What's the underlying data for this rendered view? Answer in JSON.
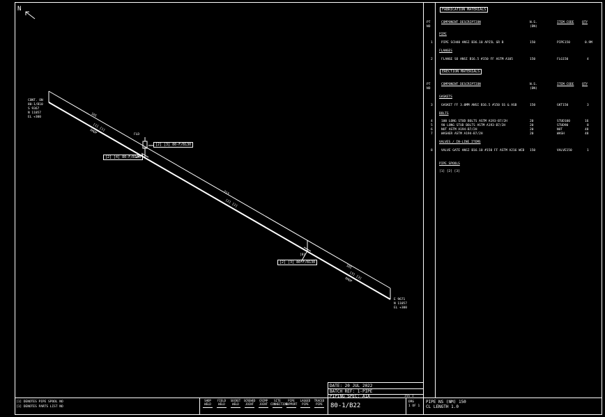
{
  "north": {
    "label": "N"
  },
  "start_point": {
    "lines": [
      "CONT. ON",
      "80-1/B10",
      "S 9367",
      "N 11057",
      "EL +300"
    ]
  },
  "end_point": {
    "lines": [
      "E 9671",
      "N 11057",
      "EL +300"
    ]
  },
  "iso": {
    "dim_1": "165",
    "dim_2": "713",
    "dim_3": "165",
    "spool_1": "[1] [1]",
    "spool_2": "[2] [2]",
    "spool_3": "[3] [3]",
    "pipe_note_1": "SHOP",
    "pipe_note_2": "SHOP",
    "field_label_1": "FLD",
    "field_label_2": "FLD",
    "weld_ref_1": "[2] [3] 80-F/B130",
    "weld_ref_2": "[2] [4] 80-F/B130",
    "weld_ref_3": "[2] [3] 80-F/B130",
    "valve_tag": "[8]"
  },
  "bom": {
    "fab_title": "FABRICATION MATERIALS",
    "ere_title": "ERECTION MATERIALS",
    "headers": {
      "pt": "PT",
      "no": "NO",
      "desc": "COMPONENT DESCRIPTION",
      "ns": "N.S.",
      "dn": "(DN)",
      "code": "ITEM CODE",
      "qty": "QTY"
    },
    "fab_groups": [
      {
        "name": "PIPE",
        "rows": [
          {
            "pt": "1",
            "desc": "PIPE SCH40 ANSI B36.10 API5L GR B",
            "ns": "150",
            "code": "PIPE150",
            "qty": "0.9M"
          }
        ]
      },
      {
        "name": "FLANGES",
        "rows": [
          {
            "pt": "2",
            "desc": "FLANGE SO ANSI B16.5 #150 FF ASTM A105",
            "ns": "150",
            "code": "FLG150",
            "qty": "4"
          }
        ]
      }
    ],
    "ere_groups": [
      {
        "name": "GASKETS",
        "rows": [
          {
            "pt": "3",
            "desc": "GASKET FF 3.0MM ANSI B16.5 #150 SS & ASB",
            "ns": "150",
            "code": "GKT150",
            "qty": "3"
          }
        ]
      },
      {
        "name": "BOLTS",
        "rows": [
          {
            "pt": "4",
            "desc": "100 LONG STUD BOLTS ASTM A193-B7/2H",
            "ns": "20",
            "code": "STUD100",
            "qty": "16"
          },
          {
            "pt": "5",
            "desc": "90 LONG STUD BOLTS ASTM A193-B7/2H",
            "ns": "20",
            "code": "STUD90",
            "qty": "8"
          },
          {
            "pt": "6",
            "desc": "NUT ASTM A194-B7/2H",
            "ns": "20",
            "code": "NUT",
            "qty": "48"
          },
          {
            "pt": "7",
            "desc": "WASHER ASTM A194-B7/2H",
            "ns": "20",
            "code": "WASH",
            "qty": "48"
          }
        ]
      },
      {
        "name": "VALVES / IN-LINE ITEMS",
        "rows": [
          {
            "pt": "8",
            "desc": "VALVE GATE ANSI B16.10 #150 FF ASTM A216 WCB",
            "ns": "150",
            "code": "VALVE150",
            "qty": "1"
          }
        ]
      }
    ],
    "spools_title": "PIPE SPOOLS",
    "spools": "[1]  [2]  [3]"
  },
  "title_block": {
    "date": "DATE: 20 JUL 2022",
    "batch": "BATCH REF: 1-PIPE",
    "spec": "PIPING SPEC: A1A",
    "iss": "ISS  1",
    "drawing_no": "80-1/B22",
    "drg_label": "DRG",
    "drg_value": "1 OF 1",
    "pipe_ns": "PIPE NS (NM)   150",
    "cl_length": "CL LENGTH    1.0"
  },
  "legend_notes": [
    "[1] DENOTES PIPE SPOOL NO",
    "[1] DENOTES PARTS LIST NO"
  ],
  "symbol_keys": [
    {
      "top": "SHOP",
      "bot": "WELD"
    },
    {
      "top": "FIELD",
      "bot": "WELD"
    },
    {
      "top": "SOCKET",
      "bot": "WELD"
    },
    {
      "top": "SCREWED",
      "bot": "JOINT"
    },
    {
      "top": "CRIMP",
      "bot": "JOINT"
    },
    {
      "top": "SITE",
      "bot": "CONNECTION"
    },
    {
      "top": "PIPE",
      "bot": "SUPPORT"
    },
    {
      "top": "LAGGED",
      "bot": "PIPE"
    },
    {
      "top": "TRACED",
      "bot": "PIPE"
    }
  ]
}
